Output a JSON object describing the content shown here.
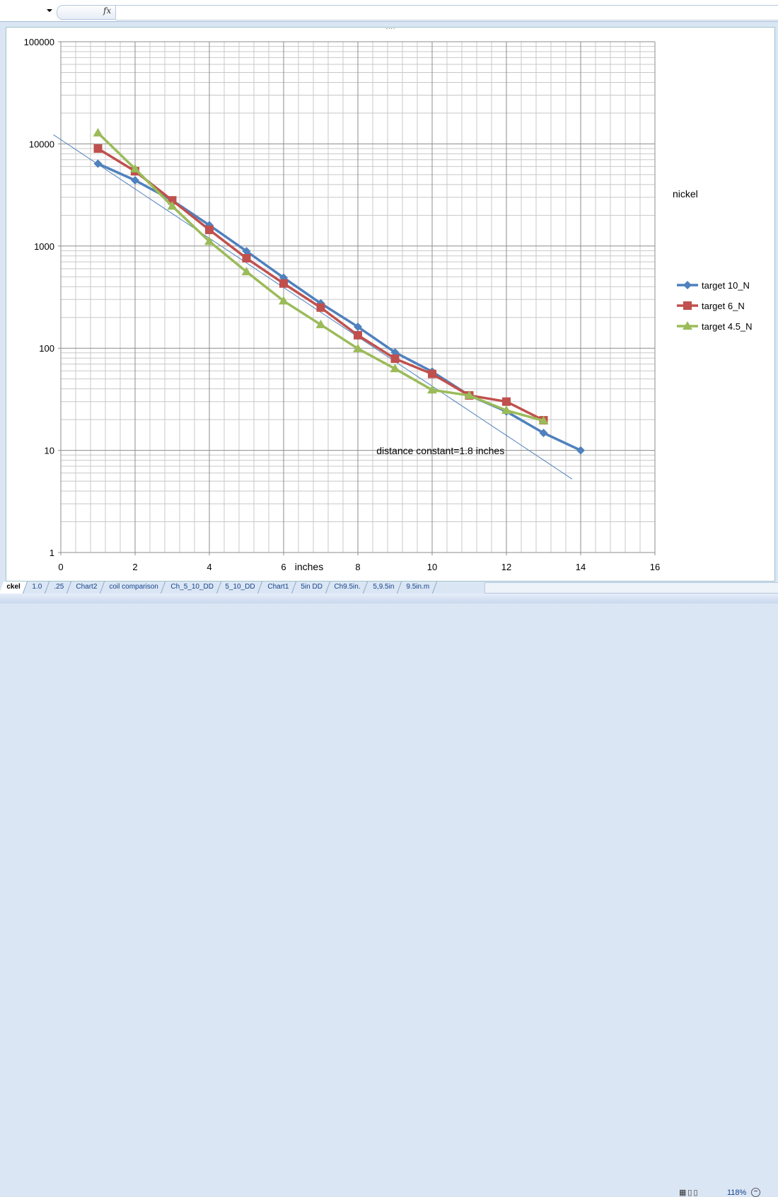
{
  "formula_bar": {
    "fx_label": "fx",
    "value": ""
  },
  "sheet_tabs": [
    "ckel",
    "1.0",
    ".25",
    "Chart2",
    "coil comparison",
    "Ch_5_10_DD",
    "5_10_DD",
    "Chart1",
    "5in DD",
    "Ch9.5in.",
    "5,9.5in",
    "9.5in.m"
  ],
  "status_bar": {
    "zoom": "118%",
    "zoom_out_label": "−"
  },
  "chart_data": {
    "type": "line",
    "title": "nickel",
    "xlabel": "inches",
    "ylabel": "",
    "xlim": [
      0,
      16
    ],
    "ylim": [
      1,
      100000
    ],
    "yscale": "log",
    "x_ticks": [
      "0",
      "2",
      "4",
      "6",
      "8",
      "10",
      "12",
      "14",
      "16"
    ],
    "y_ticks": [
      "1",
      "10",
      "100",
      "1000",
      "10000",
      "100000"
    ],
    "grid": true,
    "legend_position": "right",
    "annotation": "distance constant=1.8 inches",
    "series": [
      {
        "name": "target 10_N",
        "color": "#4f81bd",
        "marker": "diamond",
        "x": [
          1,
          2,
          3,
          4,
          5,
          6,
          7,
          8,
          9,
          10,
          11,
          12,
          13,
          14
        ],
        "values": [
          6400,
          4400,
          2800,
          1600,
          890,
          490,
          275,
          162,
          91,
          59,
          34.5,
          24,
          14.8,
          10
        ]
      },
      {
        "name": "target 6_N",
        "color": "#c0504d",
        "marker": "square",
        "x": [
          1,
          2,
          3,
          4,
          5,
          6,
          7,
          8,
          9,
          10,
          11,
          12,
          13
        ],
        "values": [
          9000,
          5400,
          2800,
          1440,
          760,
          430,
          250,
          134,
          79,
          56,
          34.5,
          30,
          19.7
        ]
      },
      {
        "name": "target 4.5_N",
        "color": "#9bbb59",
        "marker": "triangle",
        "x": [
          1,
          2,
          3,
          4,
          5,
          6,
          7,
          8,
          9,
          10,
          11,
          12,
          13
        ],
        "values": [
          12800,
          5700,
          2460,
          1110,
          560,
          290,
          170,
          99,
          63,
          39,
          34.5,
          24.6,
          19.5
        ]
      }
    ],
    "trendline": {
      "type": "exponential",
      "color": "#4f81bd",
      "x_range": [
        -0.2,
        13.77
      ],
      "a": 11000,
      "distance_constant": 1.8
    }
  }
}
